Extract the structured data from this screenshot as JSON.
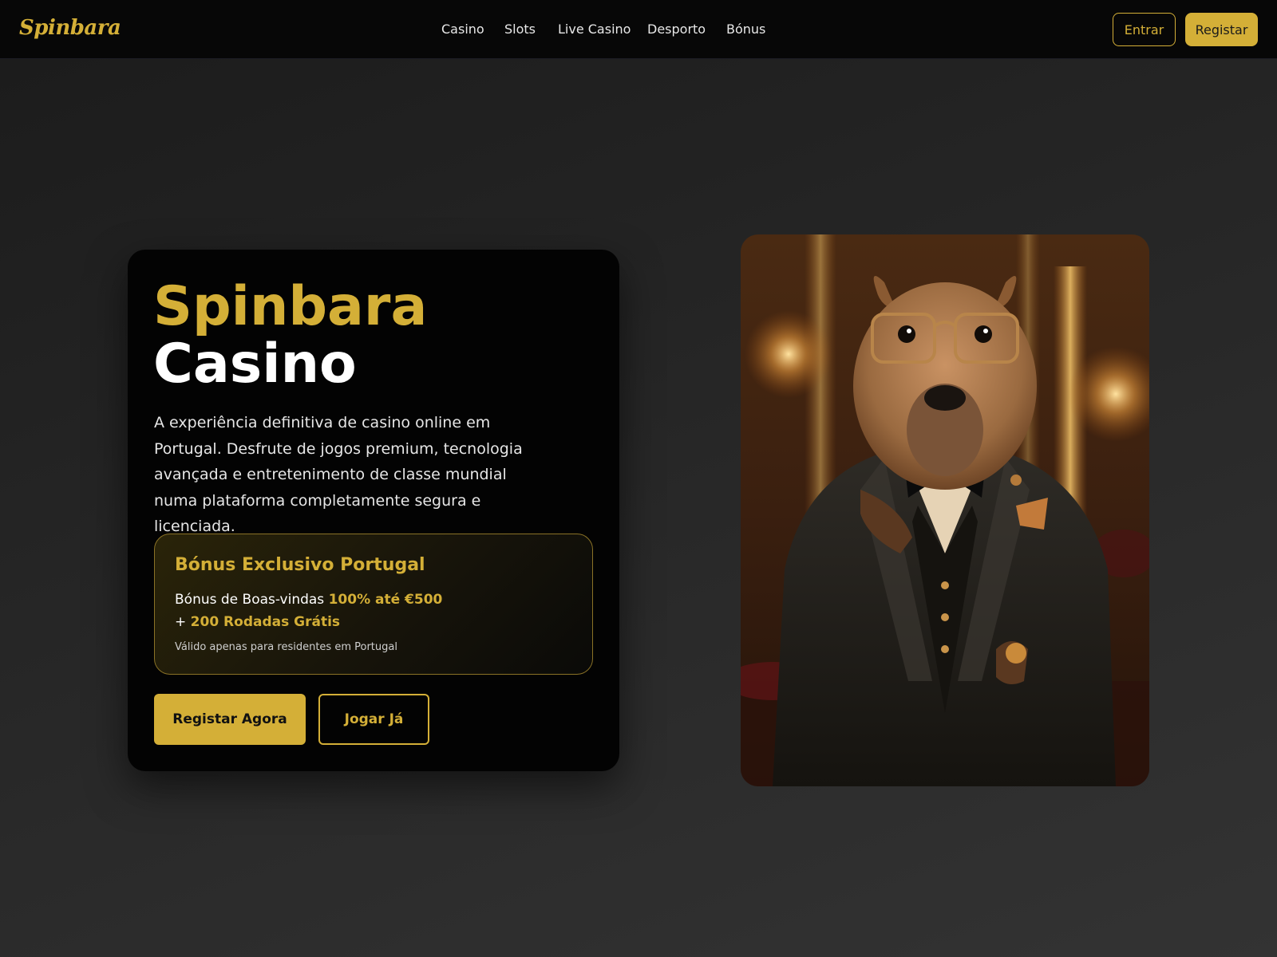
{
  "header": {
    "logo": "Spinbara",
    "nav": [
      {
        "label": "Casino"
      },
      {
        "label": "Slots"
      },
      {
        "label": "Live Casino"
      },
      {
        "label": "Desporto"
      },
      {
        "label": "Bónus"
      }
    ],
    "login_label": "Entrar",
    "register_label": "Registar"
  },
  "hero": {
    "title_line1": "Spinbara",
    "title_line2": "Casino",
    "description": "A experiência definitiva de casino online em Portugal. Desfrute de jogos premium, tecnologia avançada e entretenimento de classe mundial numa plataforma completamente segura e licenciada.",
    "bonus": {
      "title": "Bónus Exclusivo Portugal",
      "line1_prefix": "Bónus de Boas-vindas ",
      "line1_highlight": "100% até €500",
      "line2_prefix": "+ ",
      "line2_highlight": "200 Rodadas Grátis",
      "note": "Válido apenas para residentes em Portugal"
    },
    "cta_primary": "Registar Agora",
    "cta_secondary": "Jogar Já"
  },
  "illustration": {
    "subject": "capybara-mascot-in-tuxedo"
  },
  "colors": {
    "accent_gold": "#d4af37",
    "header_bg": "#070707",
    "card_bg": "#030303"
  }
}
